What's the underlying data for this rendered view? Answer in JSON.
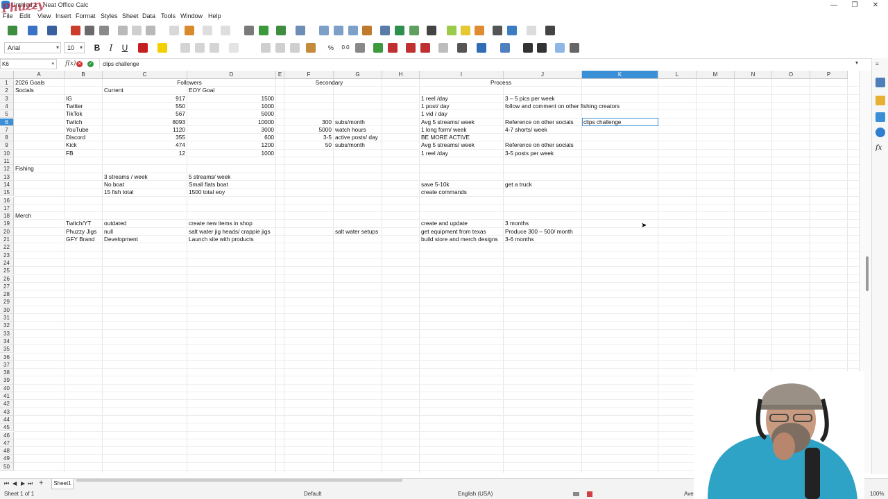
{
  "window": {
    "title": "Untitled 1 - Neat Office Calc",
    "minimize": "—",
    "maximize": "❐",
    "close": "✕"
  },
  "watermark": "Phuzzy",
  "menus": [
    "File",
    "Edit",
    "View",
    "Insert",
    "Format",
    "Styles",
    "Sheet",
    "Data",
    "Tools",
    "Window",
    "Help"
  ],
  "toolbar": {
    "font_name": "Arial",
    "font_size": "10",
    "bold": "B",
    "italic": "I",
    "underline": "U",
    "percent": "%",
    "decimal": "0.0"
  },
  "formula_bar": {
    "name_box": "K6",
    "fx": "f(x)",
    "cancel": "✕",
    "accept": "✓",
    "content": "clips challenge"
  },
  "columns": [
    "A",
    "B",
    "C",
    "D",
    "E",
    "F",
    "G",
    "H",
    "I",
    "J",
    "K",
    "L",
    "M",
    "N",
    "O",
    "P"
  ],
  "selected_column": "K",
  "selected_row": "6",
  "rows": [
    "1",
    "2",
    "3",
    "4",
    "5",
    "6",
    "7",
    "8",
    "9",
    "10",
    "11",
    "12",
    "13",
    "14",
    "15",
    "16",
    "17",
    "18",
    "19",
    "20",
    "21",
    "22",
    "23",
    "24",
    "25",
    "26",
    "27",
    "28",
    "29",
    "30",
    "31",
    "32",
    "33",
    "34",
    "35",
    "36",
    "37",
    "38",
    "39",
    "40",
    "41",
    "42",
    "43",
    "44",
    "45",
    "46",
    "47",
    "48",
    "49",
    "50"
  ],
  "cells": {
    "A1": "2026 Goals",
    "C1": "Followers",
    "F1": "Secondary",
    "I1": "Process",
    "A2": "Socials",
    "C2": "Current",
    "D2": "EOY Goal",
    "B3": "IG",
    "C3": "917",
    "D3": "1500",
    "I3": "1 reel /day",
    "J3": "3 – 5 pics per week",
    "B4": "Twitter",
    "C4": "550",
    "D4": "1000",
    "I4": "1 post/ day",
    "J4": "follow and comment on other fishing creators",
    "B5": "TikTok",
    "C5": "567",
    "D5": "5000",
    "I5": "1 vid / day",
    "B6": "Twitch",
    "C6": "8093",
    "D6": "10000",
    "F6": "300",
    "G6": "subs/month",
    "I6": "Avg 5 streams/ week",
    "J6": "Reference on other socials",
    "K6": "clips challenge",
    "B7": "YouTube",
    "C7": "1120",
    "D7": "3000",
    "F7": "5000",
    "G7": "watch hours",
    "I7": "1 long form/ week",
    "J7": "4-7 shorts/ week",
    "B8": "Discord",
    "C8": "355",
    "D8": "600",
    "F8": "3-5",
    "G8": "active posts/ day",
    "I8": "BE MORE ACTIVE",
    "B9": "Kick",
    "C9": "474",
    "D9": "1200",
    "F9": "50",
    "G9": "subs/month",
    "I9": "Avg 5 streams/ week",
    "J9": "Reference on other socials",
    "B10": "FB",
    "C10": "12",
    "D10": "1000",
    "I10": "1 reel /day",
    "J10": "3-5 posts per week",
    "A12": "Fishing",
    "C13": "3 streams / week",
    "D13": "5 streams/ week",
    "C14": "No boat",
    "D14": "Small flats boat",
    "I14": "save 5-10k",
    "J14": "get a truck",
    "C15": "15 fish total",
    "D15": "1500 total eoy",
    "I15": "create commands",
    "A18": "Merch",
    "B19": "Twitch/YT",
    "C19": "outdated",
    "D19": "create new items in shop",
    "I19": "create and update",
    "J19": " 3 months",
    "B20": "Phuzzy Jigs",
    "C20": "null",
    "D20": "salt water jig heads/ crappie jigs",
    "G20": "salt water setups",
    "I20": "get equipment from texas",
    "J20": "Produce 300 – 500/ month",
    "B21": "GFY Brand",
    "C21": "Development",
    "D21": "Launch site with products",
    "I21": "build store and merch designs",
    "J21": "3-6 months"
  },
  "sheet_tabs": [
    "Sheet1"
  ],
  "status_bar": {
    "sheet_info": "Sheet 1 of 1",
    "page_style": "Default",
    "language": "English (USA)",
    "aggregate": "Average: ; Sum: 0",
    "zoom": "100%"
  },
  "colors": {
    "selection": "#3b8fd6",
    "header_bg": "#f2f2f2",
    "webcam_shirt": "#2ea3c6"
  }
}
